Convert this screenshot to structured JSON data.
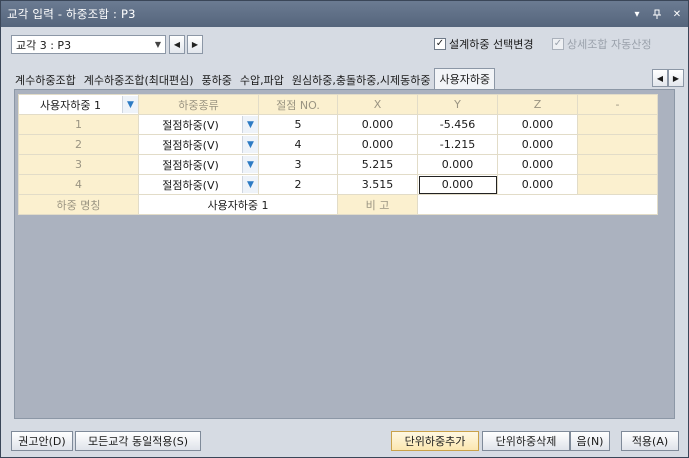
{
  "window": {
    "title": "교각 입력 - 하중조합 : P3",
    "controls": {
      "dropdown": "▾",
      "pin": "📌",
      "close": "✕"
    }
  },
  "top": {
    "pier_combo": {
      "value": "교각 3 : P3"
    },
    "nav": {
      "prev": "◀",
      "next": "▶"
    },
    "check_design": {
      "label": "설계하중 선택변경",
      "checked": true
    },
    "check_auto": {
      "label": "상세조합 자동산정",
      "checked": true,
      "disabled": true
    }
  },
  "tabs": [
    {
      "label": "계수하중조합",
      "active": false
    },
    {
      "label": "계수하중조합(최대편심)",
      "active": false
    },
    {
      "label": "풍하중",
      "active": false
    },
    {
      "label": "수압,파압",
      "active": false
    },
    {
      "label": "원심하중,충돌하중,시제동하중",
      "active": false
    },
    {
      "label": "사용자하중",
      "active": true
    }
  ],
  "grid": {
    "selector": "사용자하중 1",
    "headers": [
      "하중종류",
      "절점 NO.",
      "X",
      "Y",
      "Z",
      "-"
    ],
    "rows": [
      {
        "no": "1",
        "type": "절점하중(V)",
        "node": "5",
        "x": "0.000",
        "y": "-5.456",
        "z": "0.000",
        "extra": ""
      },
      {
        "no": "2",
        "type": "절점하중(V)",
        "node": "4",
        "x": "0.000",
        "y": "-1.215",
        "z": "0.000",
        "extra": ""
      },
      {
        "no": "3",
        "type": "절점하중(V)",
        "node": "3",
        "x": "5.215",
        "y": "0.000",
        "z": "0.000",
        "extra": ""
      },
      {
        "no": "4",
        "type": "절점하중(V)",
        "node": "2",
        "x": "3.515",
        "y": "0.000",
        "z": "0.000",
        "extra": ""
      }
    ],
    "footer": {
      "name_label": "하중 명칭",
      "name_value": "사용자하중 1",
      "remark_label": "비 고",
      "remark_value": ""
    }
  },
  "buttons": {
    "recommend": "권고안(D)",
    "apply_all": "모든교각 동일적용(S)",
    "add_unit": "단위하중추가",
    "delete_unit": "단위하중삭제",
    "next": "음(N)",
    "apply": "적용(A)"
  },
  "colors": {
    "header_bg": "#fbf0cf",
    "panel_bg": "#abb2bf",
    "titlebar": "#5f6e83",
    "accent": "#2d7bc4"
  }
}
